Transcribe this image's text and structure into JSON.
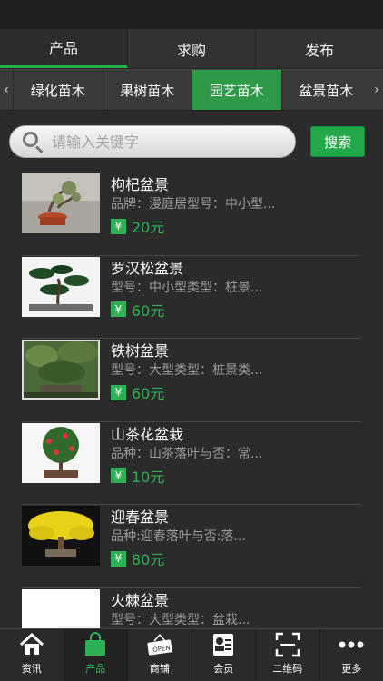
{
  "top_tabs": [
    {
      "label": "产品",
      "active": true
    },
    {
      "label": "求购",
      "active": false
    },
    {
      "label": "发布",
      "active": false
    }
  ],
  "categories": {
    "left_arrow": "‹",
    "right_arrow": "›",
    "items": [
      {
        "label": "绿化苗木",
        "active": false
      },
      {
        "label": "果树苗木",
        "active": false
      },
      {
        "label": "园艺苗木",
        "active": true
      },
      {
        "label": "盆景苗木",
        "active": false
      }
    ]
  },
  "search": {
    "placeholder": "请输入关键字",
    "button_label": "搜索"
  },
  "products": [
    {
      "name": "枸杞盆景",
      "desc": "品牌：漫庭居型号：中小型...",
      "price": "20元"
    },
    {
      "name": "罗汉松盆景",
      "desc": "型号：中小型类型：桩景...",
      "price": "60元"
    },
    {
      "name": "铁树盆景",
      "desc": "型号：大型类型：桩景类...",
      "price": "60元"
    },
    {
      "name": "山茶花盆栽",
      "desc": "品种：山茶落叶与否：常...",
      "price": "10元"
    },
    {
      "name": "迎春盆景",
      "desc": "品种:迎春落叶与否:落...",
      "price": "80元"
    },
    {
      "name": "火棘盆景",
      "desc": "型号：大型类型：盆栽...",
      "price": ""
    }
  ],
  "currency_symbol": "¥",
  "bottom_nav": [
    {
      "label": "资讯",
      "icon": "home-icon",
      "active": false
    },
    {
      "label": "产品",
      "icon": "shopping-bag-icon",
      "active": true
    },
    {
      "label": "商铺",
      "icon": "open-sign-icon",
      "active": false
    },
    {
      "label": "会员",
      "icon": "member-card-icon",
      "active": false
    },
    {
      "label": "二维码",
      "icon": "qr-scan-icon",
      "active": false
    },
    {
      "label": "更多",
      "icon": "more-dots-icon",
      "active": false
    }
  ],
  "colors": {
    "accent": "#2db154",
    "background": "#2b2b2b"
  }
}
